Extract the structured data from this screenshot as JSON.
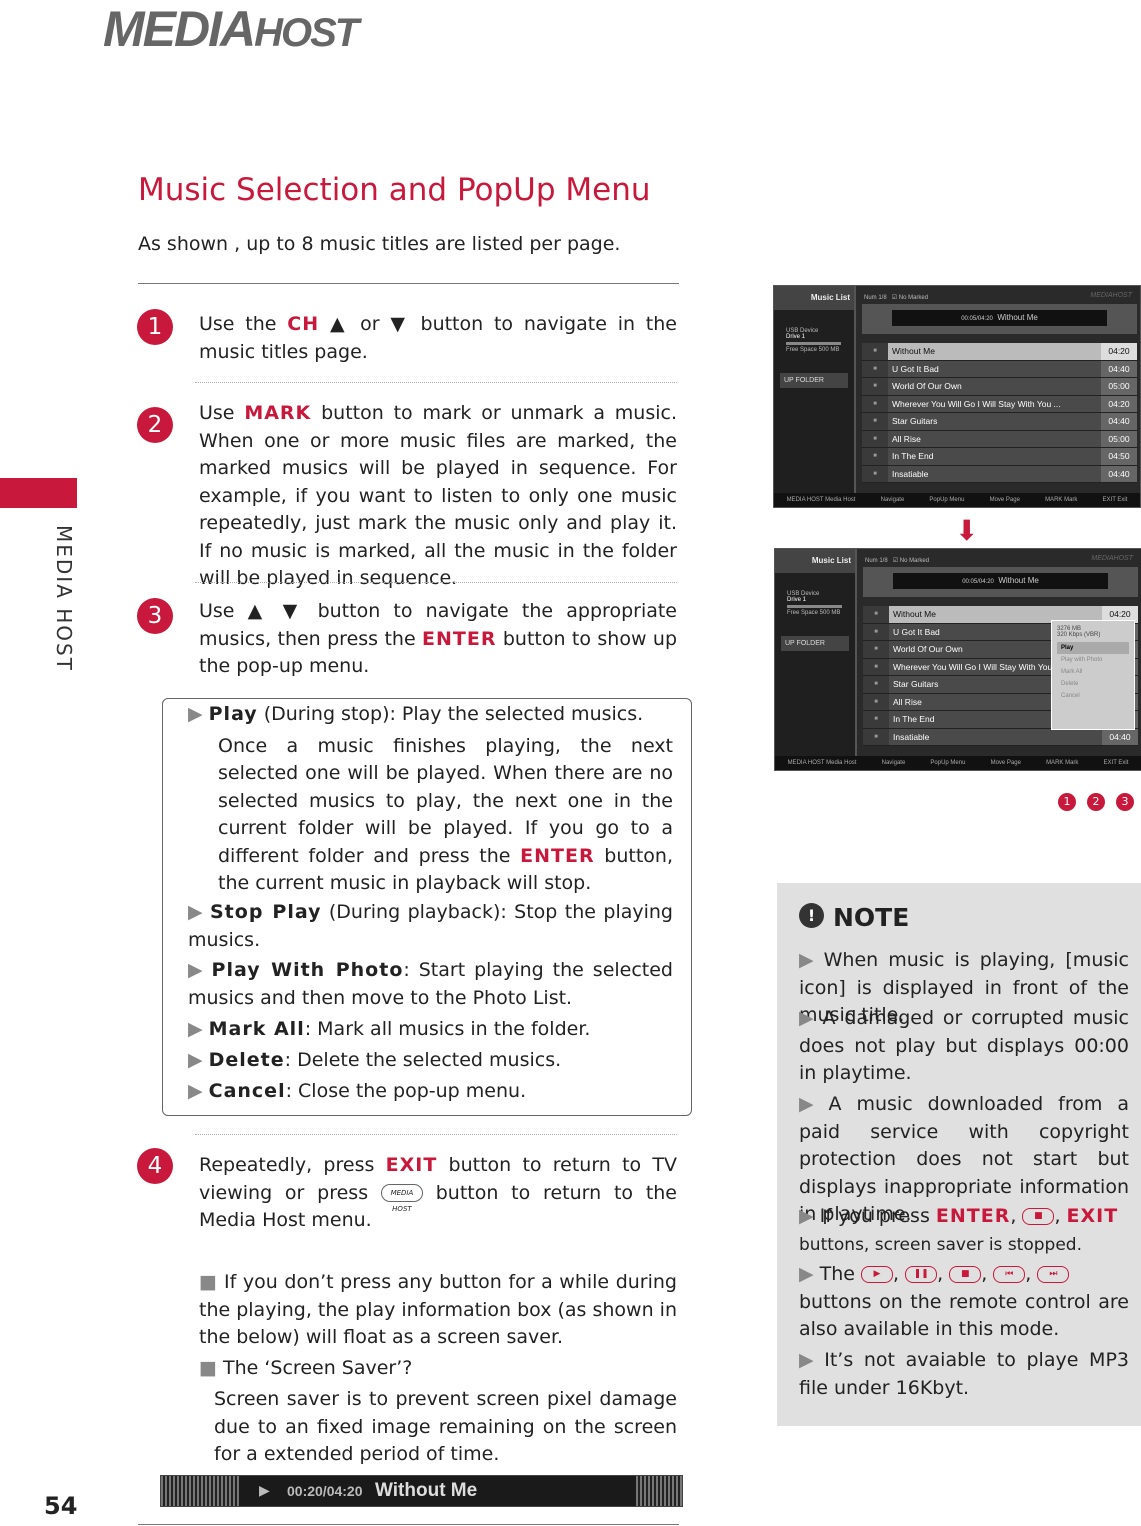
{
  "header": {
    "logo": "MEDIAHOST",
    "logo_main": "MEDIA",
    "logo_sub": "HOST",
    "side_label": "MEDIA HOST"
  },
  "title": "Music Selection and PopUp Menu",
  "subtitle": "As shown , up to 8 music titles are listed per page.",
  "steps": [
    {
      "n": "1",
      "pre": "Use the ",
      "kw": "CH",
      "post": " ▲ or ▼ button to navigate in the music titles page."
    },
    {
      "n": "2",
      "pre": "Use ",
      "kw": "MARK",
      "post": " button to mark or unmark a music. When one or more music files are marked, the marked musics will be played in sequence. For example, if you want to listen to only one music repeatedly, just mark the music only and play it. If no music is marked, all the music in the folder  will be played in sequence."
    },
    {
      "n": "3",
      "pre": "Use ▲ ▼ button to navigate the appropriate musics, then press the ",
      "kw": "ENTER",
      "post": " button to show up the pop-up menu."
    },
    {
      "n": "4",
      "pre": "Repeatedly, press ",
      "kw": "EXIT",
      "post": " button to return to TV viewing or press",
      "post2": " button to return to the Media Host menu."
    }
  ],
  "popup_options": [
    {
      "kw": "Play",
      "text": " (During stop): Play the selected musics.",
      "extra_pre": "Once a music finishes playing, the next selected one will be played. When there are no selected musics to play, the next one in the current folder will be played. If you go to a different folder and press the ",
      "extra_kw": "ENTER",
      "extra_post": " button, the current music in playback will stop."
    },
    {
      "kw": "Stop Play",
      "text": " (During playback): Stop the playing musics."
    },
    {
      "kw": "Play With Photo",
      "text": ": Start playing the selected musics and then move to the Photo List."
    },
    {
      "kw": "Mark All",
      "text": ": Mark all musics in the folder."
    },
    {
      "kw": "Delete",
      "text": ": Delete the selected musics."
    },
    {
      "kw": "Cancel",
      "text": ": Close the pop-up menu."
    }
  ],
  "screensaver": {
    "b1": "If you don’t press any button for a while during the playing, the play information box (as shown in the below) will float as a screen saver.",
    "b2": "The ‘Screen Saver’?",
    "b2_text": "Screen saver is to prevent screen pixel damage due to an fixed image remaining on the screen for a extended period of time.",
    "bar_time": "00:20/04:20",
    "bar_title": "Without Me"
  },
  "screen": {
    "header": "Music List",
    "num": "Num 1/8",
    "marked": "No Marked",
    "brand": "MEDIAHOST",
    "time": "00:05/04:20",
    "now_title": "Without Me",
    "device": "USB Device",
    "drive": "Drive 1",
    "free": "Free Space 500 MB",
    "up_folder": "UP FOLDER",
    "tracks": [
      {
        "name": "Without Me",
        "time": "04:20"
      },
      {
        "name": "U Got It Bad",
        "time": "04:40"
      },
      {
        "name": "World Of Our Own",
        "time": "05:00"
      },
      {
        "name": "Wherever You Will Go I Will Stay With You ...",
        "time": "04:20"
      },
      {
        "name": "Star Guitars",
        "time": "04:40"
      },
      {
        "name": "All Rise",
        "time": "05:00"
      },
      {
        "name": "In The End",
        "time": "04:50"
      },
      {
        "name": "Insatiable",
        "time": "04:40"
      }
    ],
    "footer": [
      "MEDIA HOST Media Host",
      "Navigate",
      "PopUp Menu",
      "Move Page",
      "MARK Mark",
      "EXIT Exit"
    ],
    "popup": {
      "size": "3276 MB",
      "bitrate": "320 Kbps (VBR)",
      "items": [
        "Play",
        "Play with Photo",
        "Mark All",
        "Delete",
        "Cancel"
      ]
    }
  },
  "step_markers": [
    "1",
    "2",
    "3"
  ],
  "note": {
    "title": "NOTE",
    "items": [
      "When music is playing, [music icon] is displayed in front of the music title.",
      "A damaged or corrupted music does not play but displays 00:00 in playtime.",
      "A music downloaded from a paid service with copyright protection does not start but displays inappropriate information in playtime."
    ],
    "i4_pre": "If you press ",
    "i4_kw1": "ENTER",
    "i4_kw2": "EXIT",
    "i4_post": "buttons, screen saver is stopped.",
    "i5_pre": "The",
    "i5_post": "buttons on the remote control are also available in this mode.",
    "i6": "It’s not avaiable to playe MP3 file under 16Kbyt."
  },
  "page_number": "54",
  "colors": {
    "accent": "#c8193c"
  }
}
